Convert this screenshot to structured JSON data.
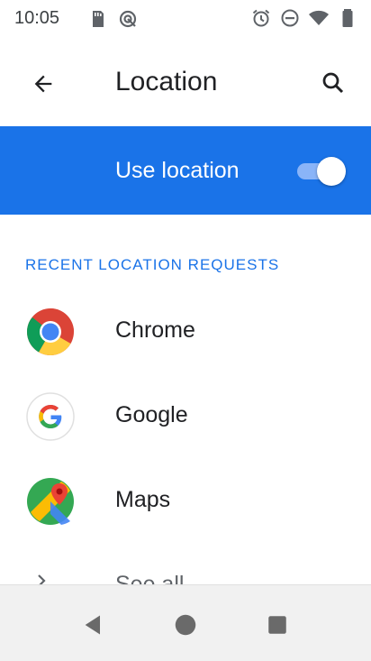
{
  "status_bar": {
    "time": "10:05",
    "left_icons": [
      "sd-card-icon",
      "signal-settings-icon"
    ],
    "right_icons": [
      "alarm-icon",
      "do-not-disturb-icon",
      "wifi-icon",
      "battery-icon"
    ]
  },
  "app_bar": {
    "title": "Location",
    "back_icon": "arrow-back-icon",
    "search_icon": "search-icon"
  },
  "master_switch": {
    "label": "Use location",
    "checked": true
  },
  "section": {
    "header": "RECENT LOCATION REQUESTS"
  },
  "apps": [
    {
      "label": "Chrome",
      "icon": "chrome-icon"
    },
    {
      "label": "Google",
      "icon": "google-icon"
    },
    {
      "label": "Maps",
      "icon": "maps-icon"
    }
  ],
  "see_all": {
    "label": "See all"
  },
  "navigation": [
    "back",
    "home",
    "recents"
  ],
  "colors": {
    "accent": "#1a73e8",
    "toggle_track": "#8ab4f8",
    "text_primary": "#202124",
    "text_secondary": "#5f6368"
  }
}
